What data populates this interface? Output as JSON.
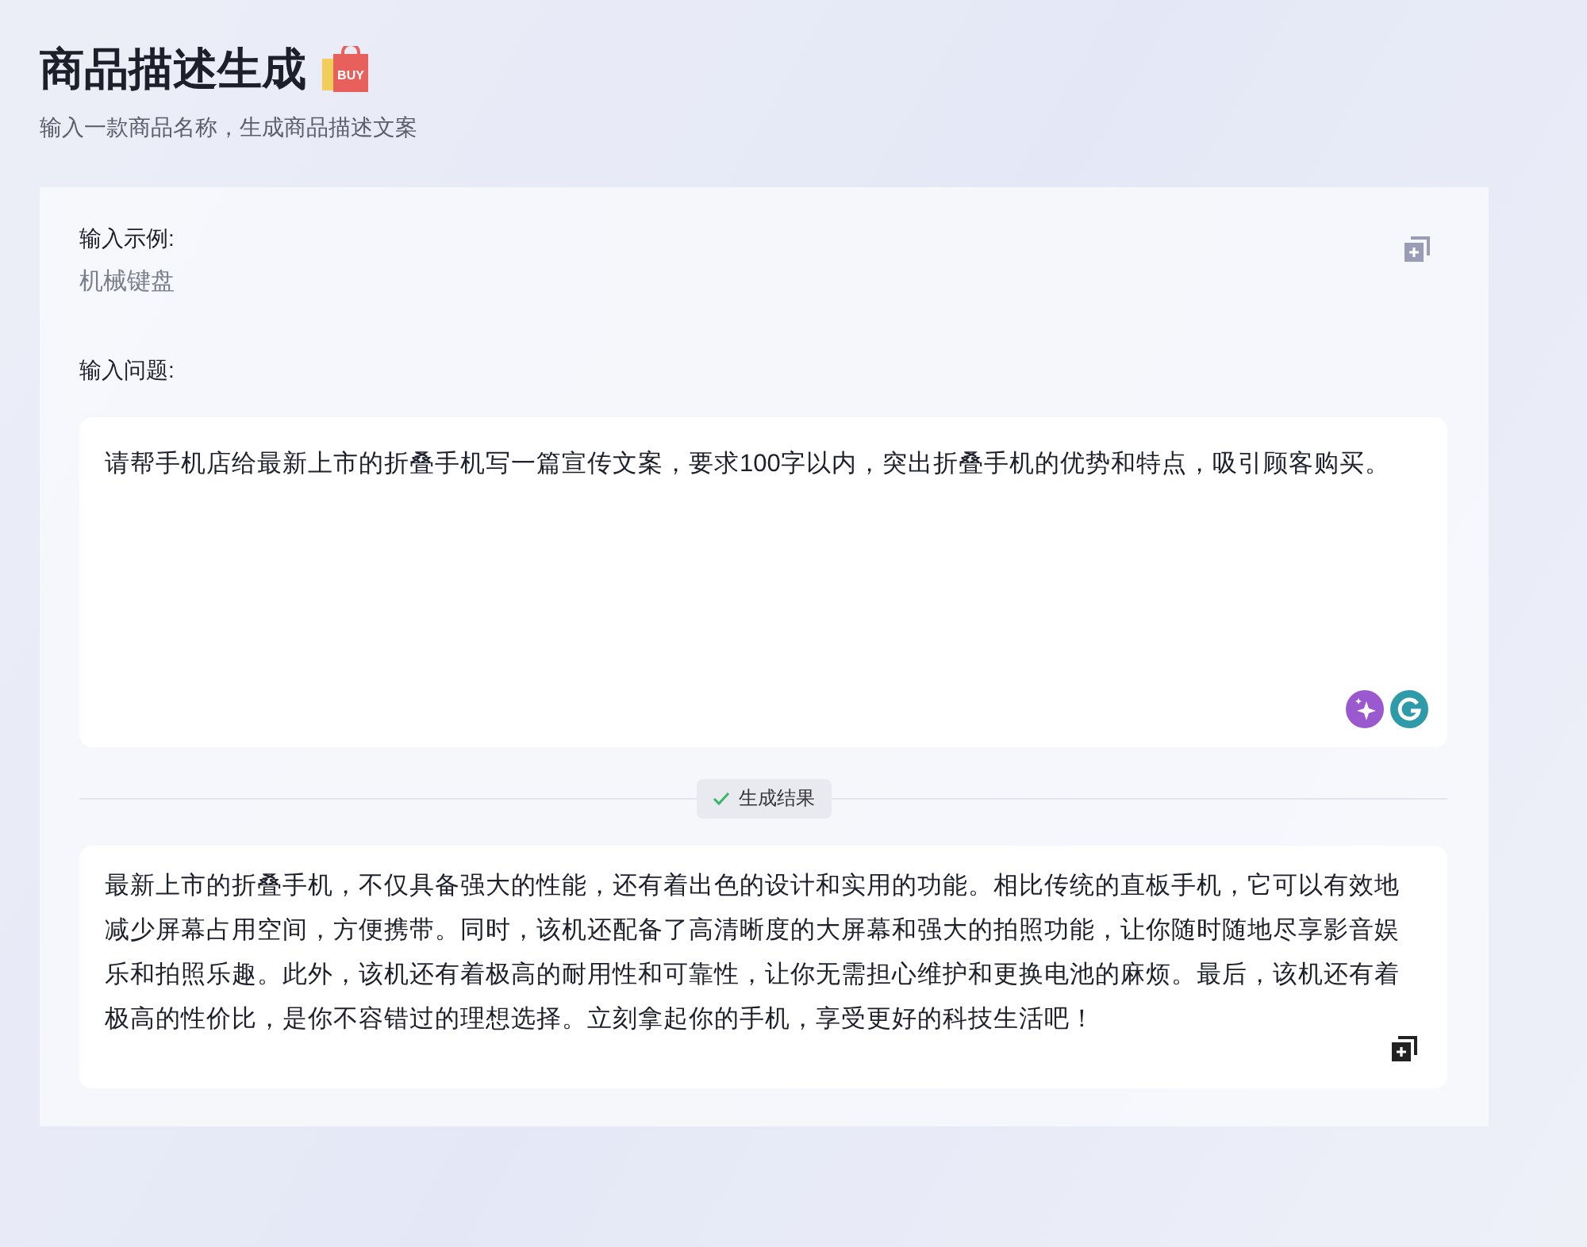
{
  "header": {
    "title": "商品描述生成",
    "title_icon": {
      "badge_text": "BUY"
    },
    "subtitle": "输入一款商品名称，生成商品描述文案"
  },
  "example": {
    "label": "输入示例:",
    "value": "机械键盘"
  },
  "question": {
    "label": "输入问题:",
    "value": "请帮手机店给最新上市的折叠手机写一篇宣传文案，要求100字以内，突出折叠手机的优势和特点，吸引顾客购买。"
  },
  "divider_chip": "生成结果",
  "result": {
    "text": "最新上市的折叠手机，不仅具备强大的性能，还有着出色的设计和实用的功能。相比传统的直板手机，它可以有效地减少屏幕占用空间，方便携带。同时，该机还配备了高清晰度的大屏幕和强大的拍照功能，让你随时随地尽享影音娱乐和拍照乐趣。此外，该机还有着极高的耐用性和可靠性，让你无需担心维护和更换电池的麻烦。最后，该机还有着极高的性价比，是你不容错过的理想选择。立刻拿起你的手机，享受更好的科技生活吧！"
  }
}
